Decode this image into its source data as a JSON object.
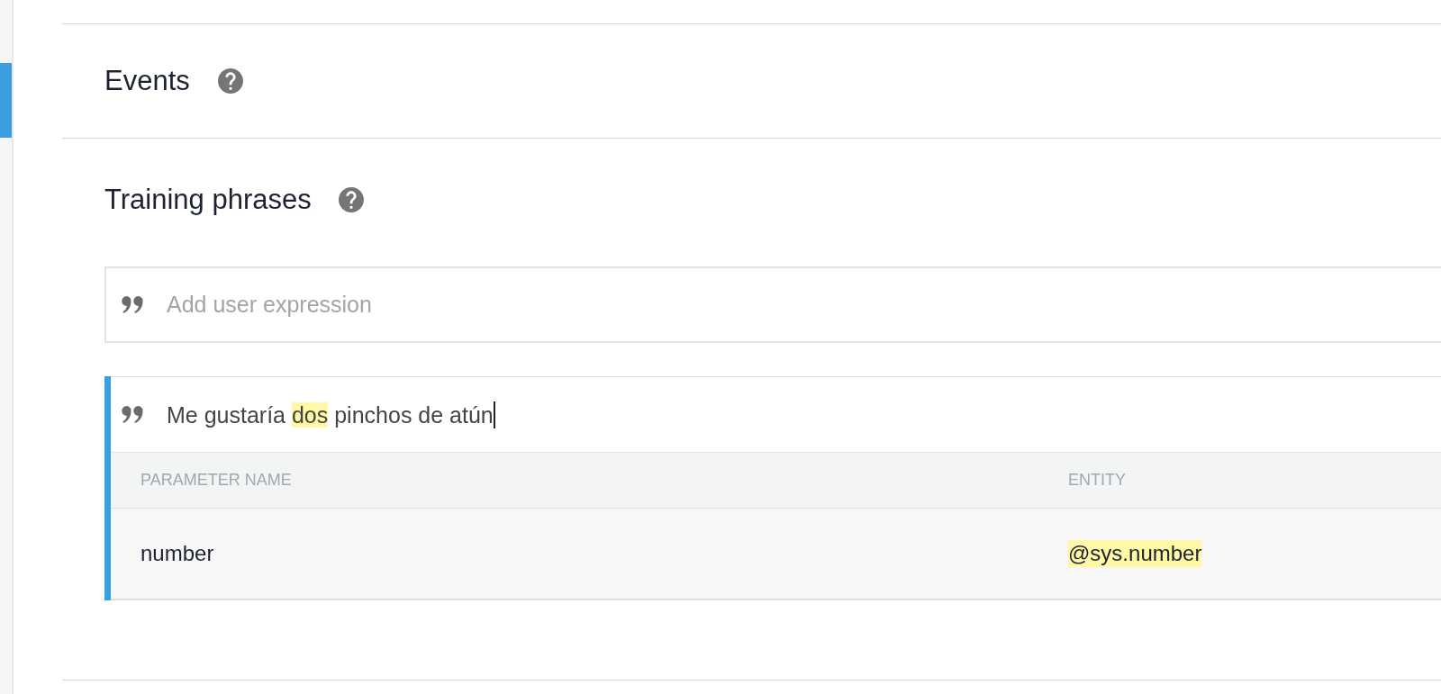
{
  "sidebar": {
    "items": [
      {
        "selected": true
      }
    ]
  },
  "events": {
    "title": "Events"
  },
  "training_phrases": {
    "title": "Training phrases",
    "new_phrase": {
      "placeholder": "Add user expression"
    },
    "phrases": [
      {
        "selected": true,
        "editing": true,
        "parts": [
          {
            "text": "Me gustaría "
          },
          {
            "text": "dos",
            "color": "#fff9a6"
          },
          {
            "text": " pinchos de atún"
          }
        ],
        "parameters": {
          "columns": [
            "PARAMETER NAME",
            "ENTITY"
          ],
          "rows": [
            {
              "parameter_name": "number",
              "entity": "@sys.number",
              "color": "#fff9a6"
            }
          ]
        }
      }
    ]
  }
}
